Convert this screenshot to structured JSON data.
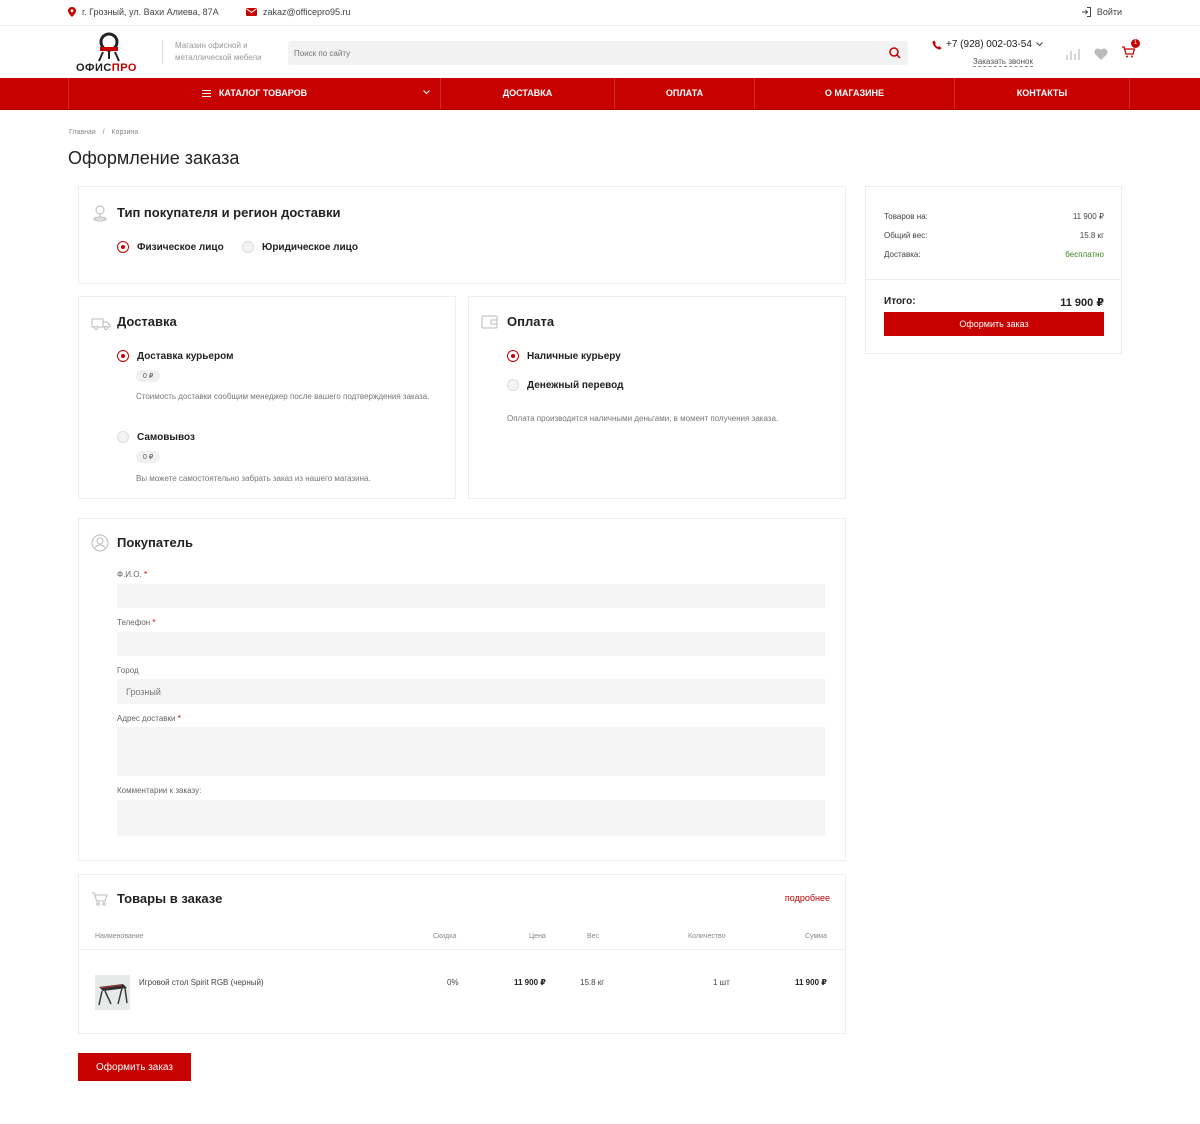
{
  "topbar": {
    "address": "г. Грозный, ул. Вахи Алиева, 87А",
    "email": "zakaz@officepro95.ru",
    "login": "Войти"
  },
  "header": {
    "logo_text": "ОФИСПРО",
    "tagline": "Магазин офисной и металлической мебели",
    "search_placeholder": "Поиск по сайту",
    "phone": "+7 (928) 002-03-54",
    "callback": "Заказать звонок",
    "cart_count": "1"
  },
  "nav": {
    "catalog": "КАТАЛОГ ТОВАРОВ",
    "delivery": "ДОСТАВКА",
    "payment": "ОПЛАТА",
    "about": "О МАГАЗИНЕ",
    "contacts": "КОНТАКТЫ"
  },
  "breadcrumb": {
    "home": "Главная",
    "sep": "/",
    "current": "Корзина"
  },
  "page_title": "Оформление заказа",
  "buyer_type": {
    "title": "Тип покупателя и регион доставки",
    "options": [
      "Физическое лицо",
      "Юридическое лицо"
    ],
    "selected": 0
  },
  "delivery": {
    "title": "Доставка",
    "options": [
      {
        "label": "Доставка курьером",
        "price": "0 ₽",
        "note": "Стоимость доставки сообщим менеджер после вашего подтверждения заказа."
      },
      {
        "label": "Самовывоз",
        "price": "0 ₽",
        "note": "Вы можете самостоятельно забрать заказ из нашего магазина."
      }
    ],
    "selected": 0
  },
  "payment": {
    "title": "Оплата",
    "options": [
      "Наличные курьеру",
      "Денежный перевод"
    ],
    "selected": 0,
    "note": "Оплата производится наличными деньгами, в момент получения заказа."
  },
  "buyer": {
    "title": "Покупатель",
    "fio_label": "Ф.И.О.",
    "phone_label": "Телефон",
    "city_label": "Город",
    "city_value": "Грозный",
    "address_label": "Адрес доставки",
    "comment_label": "Комментарии к заказу:",
    "required_mark": "*"
  },
  "order_items": {
    "title": "Товары в заказе",
    "more_link": "подробнее",
    "columns": [
      "Наименование",
      "Скидка",
      "Цена",
      "Вес",
      "Количество",
      "Сумма"
    ],
    "rows": [
      {
        "name": "Игровой стол Spirit RGB (черный)",
        "discount": "0%",
        "price": "11 900 ₽",
        "weight": "15.8 кг",
        "qty": "1 шт",
        "sum": "11 900 ₽"
      }
    ]
  },
  "summary": {
    "goods_label": "Товаров на:",
    "goods_value": "11 900 ₽",
    "weight_label": "Общий вес:",
    "weight_value": "15.8 кг",
    "delivery_label": "Доставка:",
    "delivery_value": "бесплатно",
    "total_label": "Итого:",
    "total_value": "11 900 ₽",
    "button": "Оформить заказ"
  },
  "bottom_button": "Оформить заказ",
  "colors": {
    "accent": "#c70000",
    "free_text": "#3a8a22"
  }
}
